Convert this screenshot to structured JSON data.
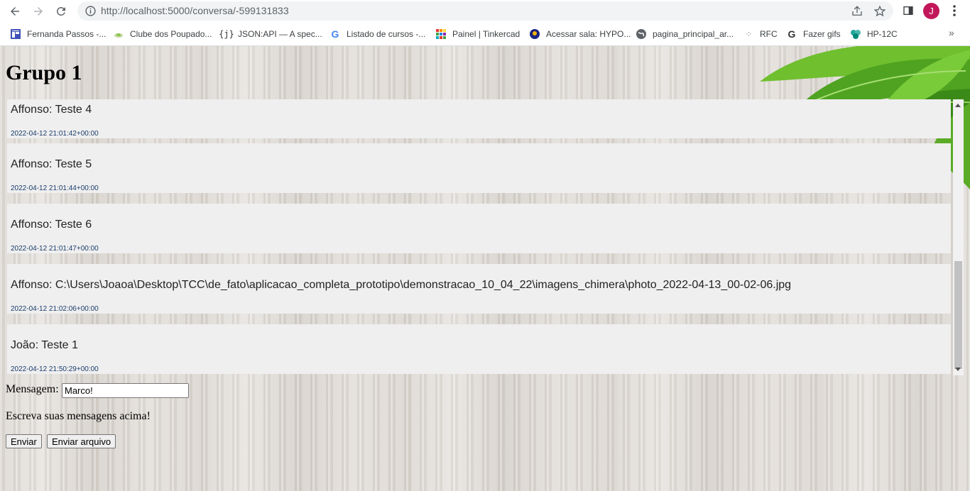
{
  "browser": {
    "url": "http://localhost:5000/conversa/-599131833",
    "profile_initial": "J",
    "bookmarks": [
      {
        "label": "Fernanda Passos -...",
        "icon": "calendar-icon"
      },
      {
        "label": "Clube dos Poupado...",
        "icon": "leaf-icon"
      },
      {
        "label": "JSON:API — A spec...",
        "icon": "json-braces-icon"
      },
      {
        "label": "Listado de cursos -...",
        "icon": "google-icon"
      },
      {
        "label": "Painel | Tinkercad",
        "icon": "tinkercad-icon"
      },
      {
        "label": "Acessar sala: HYPO...",
        "icon": "conference-icon"
      },
      {
        "label": "pagina_principal_ar...",
        "icon": "globe-icon"
      },
      {
        "label": "RFC",
        "icon": "dots-icon"
      },
      {
        "label": "Fazer gifs",
        "icon": "google-icon"
      },
      {
        "label": "HP-12C",
        "icon": "app-icon"
      }
    ]
  },
  "page": {
    "title": "Grupo 1",
    "messages": [
      {
        "text": "Affonso: Teste 4",
        "time": "2022-04-12 21:01:42+00:00"
      },
      {
        "text": "Affonso: Teste 5",
        "time": "2022-04-12 21:01:44+00:00"
      },
      {
        "text": "Affonso: Teste 6",
        "time": "2022-04-12 21:01:47+00:00"
      },
      {
        "text": "Affonso: C:\\Users\\Joaoa\\Desktop\\TCC\\de_fato\\aplicacao_completa_prototipo\\demonstracao_10_04_22\\imagens_chimera\\photo_2022-04-13_00-02-06.jpg",
        "time": "2022-04-12 21:02:06+00:00"
      },
      {
        "text": "João: Teste 1",
        "time": "2022-04-12 21:50:29+00:00"
      }
    ],
    "form": {
      "label": "Mensagem:",
      "value": "Marco!",
      "hint": "Escreva suas mensagens acima!",
      "send_label": "Enviar",
      "send_file_label": "Enviar arquivo"
    }
  }
}
